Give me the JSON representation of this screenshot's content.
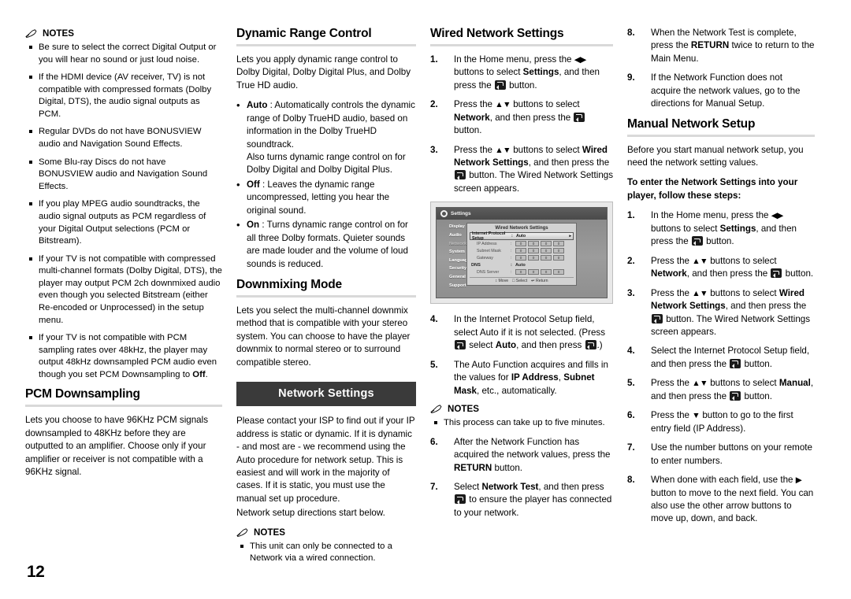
{
  "page": {
    "number": "12"
  },
  "notes_label": "NOTES",
  "col1": {
    "notes": [
      "Be sure to select the correct Digital Output or you will hear no sound or just loud noise.",
      "If the HDMI device (AV receiver, TV) is not compatible with compressed formats (Dolby Digital, DTS), the audio signal outputs as PCM.",
      "Regular DVDs do not have BONUSVIEW audio and Navigation Sound Effects.",
      "Some Blu-ray Discs do not have BONUSVIEW audio and Navigation Sound Effects.",
      "If you play MPEG audio soundtracks, the audio signal outputs as PCM regardless of your Digital Output selections (PCM or Bitstream).",
      "If your TV is not compatible with compressed multi-channel formats (Dolby Digital, DTS), the player may output PCM 2ch downmixed audio even though you selected Bitstream (either Re-encoded or Unprocessed) in the setup menu.",
      "If your TV is not compatible with PCM sampling rates over 48kHz, the player may output 48kHz downsampled PCM audio even though you set PCM Downsampling to Off."
    ],
    "note7_bold_tail": "Off",
    "pcm_heading": "PCM Downsampling",
    "pcm_body": "Lets you choose to have 96KHz PCM signals downsampled to 48KHz before they are outputted to an amplifier. Choose only if your amplifier or receiver is not compatible with a 96KHz signal."
  },
  "col2": {
    "drc_heading": "Dynamic Range Control",
    "drc_intro": "Lets you apply dynamic range control to Dolby Digital, Dolby Digital Plus, and Dolby True HD audio.",
    "drc_options": [
      {
        "name": "Auto",
        "text": " : Automatically controls the dynamic range of Dolby TrueHD audio, based on information in the Dolby TrueHD soundtrack.",
        "extra": "Also turns dynamic range control on for Dolby Digital and Dolby Digital Plus."
      },
      {
        "name": "Off",
        "text": " : Leaves the dynamic range uncompressed, letting you hear the original sound.",
        "extra": ""
      },
      {
        "name": "On",
        "text": " : Turns dynamic range control on for all three Dolby formats. Quieter sounds are made louder and the volume of loud sounds is reduced.",
        "extra": ""
      }
    ],
    "downmix_heading": "Downmixing Mode",
    "downmix_body": "Lets you select the multi-channel downmix method that is compatible with your stereo system. You can choose to have the player downmix to normal stereo or to surround compatible stereo.",
    "banner": "Network Settings",
    "net_body": "Please contact your ISP to find out if your IP address is static or dynamic. If it is dynamic - and most are - we recommend using the Auto procedure for network setup. This is easiest and will work in the majority of cases. If it is static, you must use the manual set up procedure.",
    "net_body2": "Network setup directions start below.",
    "notes": [
      "This unit can only be connected to a Network via a wired connection."
    ]
  },
  "col3": {
    "heading": "Wired Network Settings",
    "steps": [
      {
        "n": "1.",
        "parts": [
          {
            "t": "In the Home menu, press the "
          },
          {
            "t": "◀▶",
            "cls": "arr"
          },
          {
            "t": " buttons to select "
          },
          {
            "t": "Settings",
            "b": true
          },
          {
            "t": ", and then press the "
          },
          {
            "icon": "enter-key"
          },
          {
            "t": " button."
          }
        ]
      },
      {
        "n": "2.",
        "parts": [
          {
            "t": "Press the "
          },
          {
            "t": "▲▼",
            "cls": "arr"
          },
          {
            "t": " buttons to select "
          },
          {
            "t": "Network",
            "b": true
          },
          {
            "t": ", and then press the "
          },
          {
            "icon": "enter-key"
          },
          {
            "t": " button."
          }
        ]
      },
      {
        "n": "3.",
        "parts": [
          {
            "t": "Press the "
          },
          {
            "t": "▲▼",
            "cls": "arr"
          },
          {
            "t": " buttons to select "
          },
          {
            "t": "Wired Network Settings",
            "b": true
          },
          {
            "t": ", and then press the "
          },
          {
            "icon": "enter-key"
          },
          {
            "t": " button. The Wired Network Settings screen appears."
          }
        ]
      }
    ],
    "steps2": [
      {
        "n": "4.",
        "parts": [
          {
            "t": "In the Internet Protocol Setup field, select Auto if it is not selected. (Press "
          },
          {
            "icon": "enter-key"
          },
          {
            "t": " select "
          },
          {
            "t": "Auto",
            "b": true
          },
          {
            "t": ", and then press "
          },
          {
            "icon": "enter-key"
          },
          {
            "t": ".)"
          }
        ]
      },
      {
        "n": "5.",
        "parts": [
          {
            "t": "The Auto Function acquires and fills in the values for "
          },
          {
            "t": "IP Address",
            "b": true
          },
          {
            "t": ", "
          },
          {
            "t": "Subnet Mask",
            "b": true
          },
          {
            "t": ", etc., automatically."
          }
        ]
      }
    ],
    "notes": [
      "This process can take up to five minutes."
    ],
    "steps3": [
      {
        "n": "6.",
        "parts": [
          {
            "t": "After the Network Function has acquired the network values, press the "
          },
          {
            "t": "RETURN",
            "b": true
          },
          {
            "t": " button."
          }
        ]
      },
      {
        "n": "7.",
        "parts": [
          {
            "t": "Select "
          },
          {
            "t": "Network Test",
            "b": true
          },
          {
            "t": ", and then press "
          },
          {
            "icon": "enter-key"
          },
          {
            "t": " to ensure the player has connected to your network."
          }
        ]
      }
    ],
    "tv": {
      "window_title": "Settings",
      "sidebar": [
        "Display",
        "Audio",
        "Network",
        "System",
        "Language",
        "Security",
        "General",
        "Support"
      ],
      "sidebar_active": "Network",
      "dialog_title": "Wired Network Settings",
      "rows": [
        {
          "label": "Internet Protocol Setup",
          "value": "Auto",
          "selected": true,
          "type": "select"
        },
        {
          "label": "IP Address",
          "value": "",
          "type": "octets",
          "octets": [
            "0",
            "0",
            "0",
            "0"
          ]
        },
        {
          "label": "Subnet Mask",
          "value": "",
          "type": "octets",
          "octets": [
            "0",
            "0",
            "0",
            "0"
          ]
        },
        {
          "label": "Gateway",
          "value": "",
          "type": "octets",
          "octets": [
            "0",
            "0",
            "0",
            "0"
          ]
        },
        {
          "label": "DNS",
          "value": "Auto",
          "type": "header"
        },
        {
          "label": "DNS Server",
          "value": "",
          "type": "octets",
          "octets": [
            "0",
            "0",
            "0",
            "0"
          ]
        }
      ],
      "footer": [
        {
          "key": "↕",
          "label": "Move"
        },
        {
          "key": "□",
          "label": "Select"
        },
        {
          "key": "↩",
          "label": "Return"
        }
      ]
    }
  },
  "col4": {
    "steps": [
      {
        "n": "8.",
        "parts": [
          {
            "t": "When the Network Test is complete, press the "
          },
          {
            "t": "RETURN",
            "b": true
          },
          {
            "t": " twice to return to the Main Menu."
          }
        ]
      },
      {
        "n": "9.",
        "parts": [
          {
            "t": "If the Network Function does not acquire the network values, go to the directions for Manual Setup."
          }
        ]
      }
    ],
    "manual_heading": "Manual Network Setup",
    "manual_intro": "Before you start manual network setup, you need the network setting values.",
    "manual_subheading": "To enter the Network Settings into your player, follow these steps:",
    "steps2": [
      {
        "n": "1.",
        "parts": [
          {
            "t": "In the Home menu, press the "
          },
          {
            "t": "◀▶",
            "cls": "arr"
          },
          {
            "t": " buttons to select "
          },
          {
            "t": "Settings",
            "b": true
          },
          {
            "t": ", and then press the "
          },
          {
            "icon": "enter-key"
          },
          {
            "t": " button."
          }
        ]
      },
      {
        "n": "2.",
        "parts": [
          {
            "t": "Press the "
          },
          {
            "t": "▲▼",
            "cls": "arr"
          },
          {
            "t": " buttons to select "
          },
          {
            "t": "Network",
            "b": true
          },
          {
            "t": ", and then press the "
          },
          {
            "icon": "enter-key"
          },
          {
            "t": " button."
          }
        ]
      },
      {
        "n": "3.",
        "parts": [
          {
            "t": "Press the "
          },
          {
            "t": "▲▼",
            "cls": "arr"
          },
          {
            "t": " buttons to select "
          },
          {
            "t": "Wired Network Settings",
            "b": true
          },
          {
            "t": ", and then press the "
          },
          {
            "icon": "enter-key"
          },
          {
            "t": " button. The Wired Network Settings screen appears."
          }
        ]
      },
      {
        "n": "4.",
        "parts": [
          {
            "t": "Select the Internet Protocol Setup field, and then press the "
          },
          {
            "icon": "enter-key"
          },
          {
            "t": " button."
          }
        ]
      },
      {
        "n": "5.",
        "parts": [
          {
            "t": "Press the "
          },
          {
            "t": "▲▼",
            "cls": "arr"
          },
          {
            "t": " buttons to select "
          },
          {
            "t": "Manual",
            "b": true
          },
          {
            "t": ", and then press the "
          },
          {
            "icon": "enter-key"
          },
          {
            "t": " button."
          }
        ]
      },
      {
        "n": "6.",
        "parts": [
          {
            "t": "Press the "
          },
          {
            "t": "▼",
            "cls": "arr"
          },
          {
            "t": " button to go to the first entry field (IP Address)."
          }
        ]
      },
      {
        "n": "7.",
        "parts": [
          {
            "t": "Use the number buttons on your remote to enter numbers."
          }
        ]
      },
      {
        "n": "8.",
        "parts": [
          {
            "t": "When done with each field, use the "
          },
          {
            "t": "▶",
            "cls": "arr"
          },
          {
            "t": " button to move to the next field. You can also use the other arrow buttons to move up, down, and back."
          }
        ]
      }
    ]
  }
}
